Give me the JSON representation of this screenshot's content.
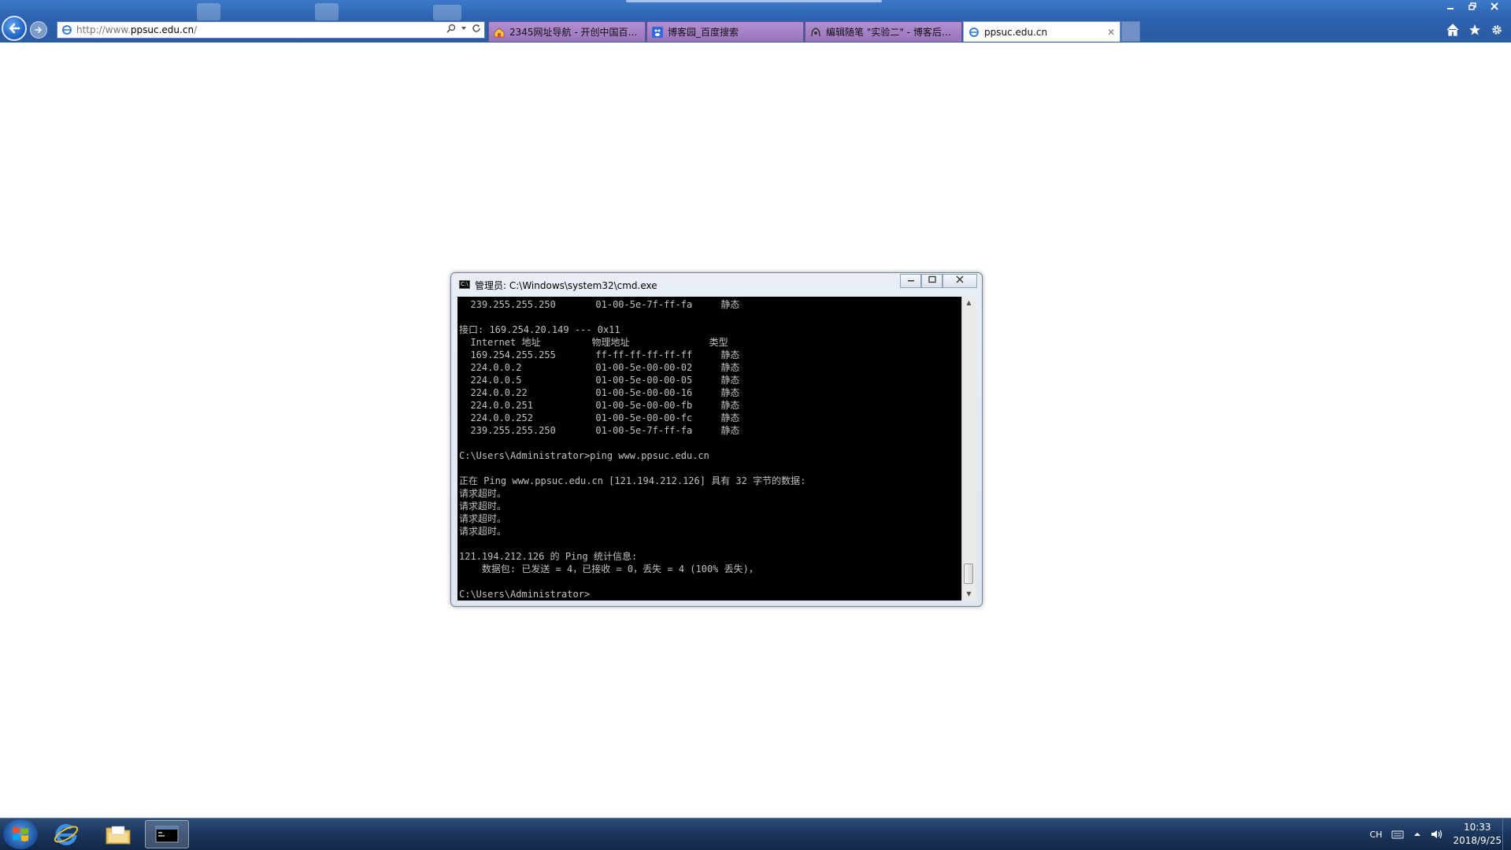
{
  "browser": {
    "url_prefix": "http://www.",
    "url_domain": "ppsuc.edu.cn",
    "url_suffix": "/",
    "tabs": [
      {
        "label": "2345网址导航 - 开创中国百年...",
        "icon": "home-page-icon",
        "active": false
      },
      {
        "label": "博客园_百度搜索",
        "icon": "baidu-paw-icon",
        "active": false
      },
      {
        "label": "编辑随笔 \"实验二\" - 博客后台...",
        "icon": "blog-icon",
        "active": false
      },
      {
        "label": "ppsuc.edu.cn",
        "icon": "ie-page-icon",
        "active": true
      }
    ],
    "close_tab_glyph": "✕"
  },
  "cmd": {
    "title": "管理员: C:\\Windows\\system32\\cmd.exe",
    "console_lines": [
      "  239.255.255.250       01-00-5e-7f-ff-fa     静态",
      "",
      "接口: 169.254.20.149 --- 0x11",
      "  Internet 地址         物理地址              类型",
      "  169.254.255.255       ff-ff-ff-ff-ff-ff     静态",
      "  224.0.0.2             01-00-5e-00-00-02     静态",
      "  224.0.0.5             01-00-5e-00-00-05     静态",
      "  224.0.0.22            01-00-5e-00-00-16     静态",
      "  224.0.0.251           01-00-5e-00-00-fb     静态",
      "  224.0.0.252           01-00-5e-00-00-fc     静态",
      "  239.255.255.250       01-00-5e-7f-ff-fa     静态",
      "",
      "C:\\Users\\Administrator>ping www.ppsuc.edu.cn",
      "",
      "正在 Ping www.ppsuc.edu.cn [121.194.212.126] 具有 32 字节的数据:",
      "请求超时。",
      "请求超时。",
      "请求超时。",
      "请求超时。",
      "",
      "121.194.212.126 的 Ping 统计信息:",
      "    数据包: 已发送 = 4，已接收 = 0，丢失 = 4 (100% 丢失)，",
      "",
      "C:\\Users\\Administrator>"
    ]
  },
  "taskbar": {
    "apps": [
      {
        "name": "internet-explorer",
        "icon": "ie-icon"
      },
      {
        "name": "file-explorer",
        "icon": "folder-icon"
      },
      {
        "name": "command-prompt",
        "icon": "cmd-icon"
      }
    ],
    "tray": {
      "language": "CH",
      "time": "10:33",
      "date": "2018/9/25"
    }
  },
  "colors": {
    "console_bg": "#000000",
    "console_fg": "#c0c0c0",
    "taskbar": "#1b355c",
    "tab_inactive": "#a783c8"
  }
}
